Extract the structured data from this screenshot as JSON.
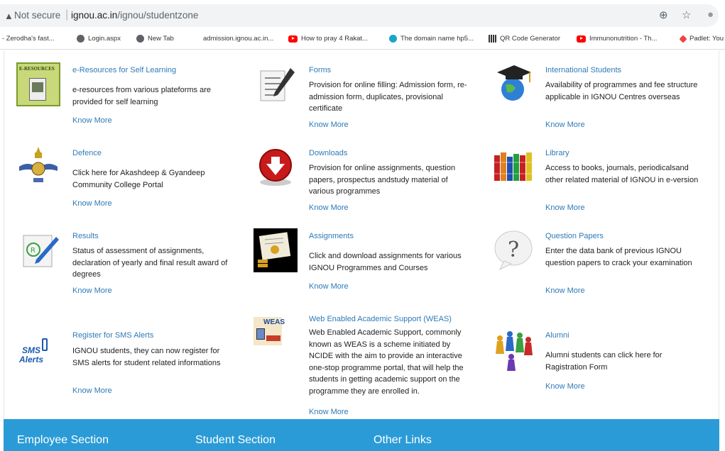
{
  "browser": {
    "security_label": "Not secure",
    "url_host": "ignou.ac.in",
    "url_path": "/ignou/studentzone",
    "bookmarks": [
      {
        "label": "- Zerodha's fast...",
        "icon": "none"
      },
      {
        "label": "Login.aspx",
        "icon": "globe-icon"
      },
      {
        "label": "New Tab",
        "icon": "globe-icon"
      },
      {
        "label": "admission.ignou.ac.in...",
        "icon": "none"
      },
      {
        "label": "How to pray 4 Rakat...",
        "icon": "youtube-icon"
      },
      {
        "label": "The domain name hp5...",
        "icon": "domain-icon"
      },
      {
        "label": "QR Code Generator",
        "icon": "qr-icon"
      },
      {
        "label": "Immunonutrition - Th...",
        "icon": "youtube-icon"
      },
      {
        "label": "Padlet: You",
        "icon": "padlet-icon"
      }
    ]
  },
  "cards": {
    "eresources": {
      "title": "e-Resources for Self Learning",
      "desc": "e-resources from various plateforms are provided for self learning",
      "more": "Know More",
      "icon_text": "E-RESOURCES",
      "icon": "book-icon"
    },
    "forms": {
      "title": "Forms",
      "desc": "Provision for online filling: Admission form, re-admission form, duplicates, provisional certificate",
      "more": "Know More",
      "icon": "form-pen-icon"
    },
    "international": {
      "title": "International Students",
      "desc": "Availability of programmes and fee structure applicable in IGNOU Centres overseas",
      "more": "Know More",
      "icon": "graduation-globe-icon"
    },
    "defence": {
      "title": "Defence",
      "desc": "Click here for Akashdeep & Gyandeep Community College Portal",
      "more": "Know More",
      "icon": "air-force-emblem-icon"
    },
    "downloads": {
      "title": "Downloads",
      "desc": "Provision for online assignments, question papers, prospectus andstudy material of various programmes",
      "more": "Know More",
      "icon": "download-icon"
    },
    "library": {
      "title": "Library",
      "desc": "Access to books, journals, periodicalsand other related material of IGNOU in e-version",
      "more": "Know More",
      "icon": "books-icon"
    },
    "results": {
      "title": "Results",
      "desc": "Status of assessment of assignments, declaration of yearly and final result award of degrees",
      "more": "Know More",
      "icon": "result-pen-icon"
    },
    "assignments": {
      "title": "Assignments",
      "desc": "Click and download assignments for various IGNOU Programmes and Courses",
      "more": "Know More",
      "icon": "certificate-icon"
    },
    "question_papers": {
      "title": "Question Papers",
      "desc": "Enter the data bank of previous IGNOU question papers to crack your examination",
      "more": "Know More",
      "icon": "question-bubble-icon"
    },
    "sms": {
      "title": "Register for SMS Alerts",
      "desc": "IGNOU students, they can now register for SMS alerts for student related informations",
      "more": "Know More",
      "icon_line1": "SMS",
      "icon_line2": "Alerts",
      "icon": "sms-alerts-icon"
    },
    "weas": {
      "title": "Web Enabled Academic Support (WEAS)",
      "desc": "Web Enabled Academic Support, commonly known as WEAS is a scheme initiated by NCIDE with the aim to provide an interactive one-stop programme portal, that will help the students in getting academic support on the programme they are enrolled in.",
      "more": "Know More",
      "icon_text": "WEAS",
      "icon": "weas-icon"
    },
    "alumni": {
      "title": "Alumni",
      "desc": "Alumni students can click here for Ragistration Form",
      "more": "Know More",
      "icon": "alumni-people-icon"
    }
  },
  "footer": {
    "employee": "Employee Section",
    "student": "Student Section",
    "other": "Other Links"
  },
  "colors": {
    "link": "#2e7ab8",
    "footer_bg": "#2b9bd7"
  }
}
